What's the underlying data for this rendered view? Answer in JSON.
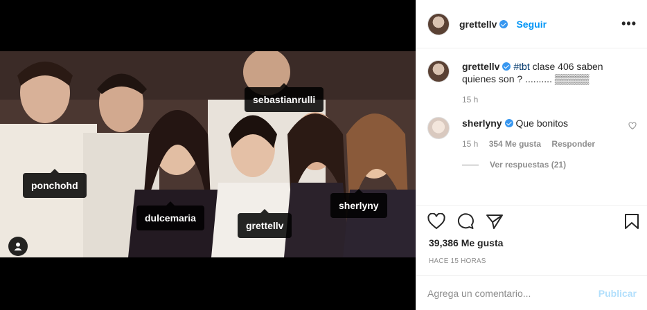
{
  "post": {
    "author": "grettellv",
    "follow_label": "Seguir",
    "more_label": "•••"
  },
  "photo_tags": [
    {
      "label": "sebastianrulli"
    },
    {
      "label": "ponchohd"
    },
    {
      "label": "dulcemaria"
    },
    {
      "label": "grettellv"
    },
    {
      "label": "sherlyny"
    }
  ],
  "caption": {
    "user": "grettellv",
    "hashtag": "#tbt",
    "text": " clase 406 saben quienes son ? .......... ▒▒▒▒▒",
    "time": "15 h"
  },
  "comment": {
    "user": "sherlyny",
    "text": "Que bonitos",
    "time": "15 h",
    "likes": "354 Me gusta",
    "reply_label": "Responder",
    "view_replies": "Ver respuestas (21)"
  },
  "likes_text": "39,386 Me gusta",
  "time_ago": "HACE 15 HORAS",
  "add_comment": {
    "placeholder": "Agrega un comentario...",
    "publish_label": "Publicar"
  },
  "colors": {
    "accent": "#0095f6",
    "verified": "#3897f0",
    "muted": "#8e8e8e",
    "publish_disabled": "#b2dffc"
  },
  "icons": [
    "heart-icon",
    "comment-icon",
    "share-icon",
    "bookmark-icon",
    "user-tag-icon",
    "verified-badge-icon",
    "more-options-icon"
  ]
}
